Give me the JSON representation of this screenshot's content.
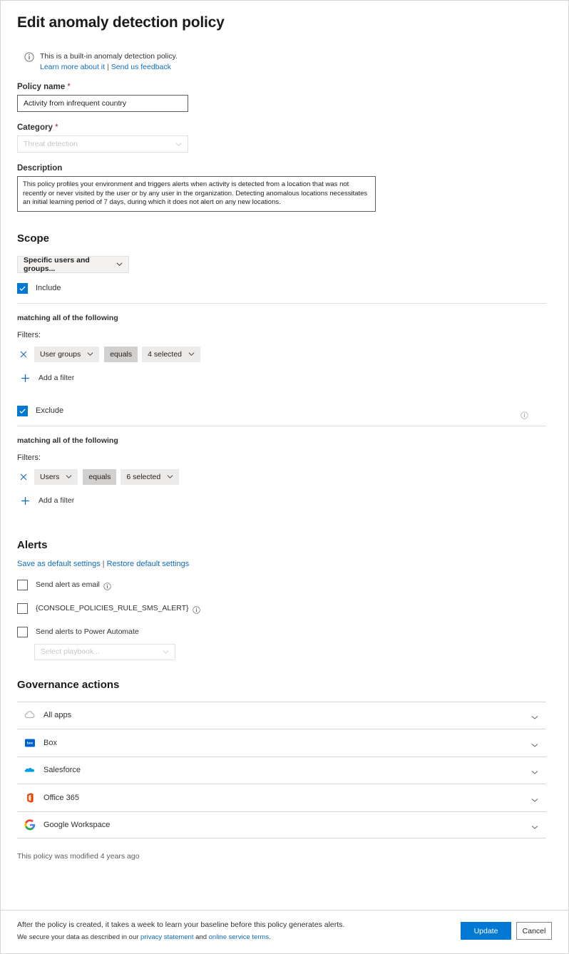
{
  "page": {
    "title": "Edit anomaly detection policy"
  },
  "banner": {
    "text": "This is a built-in anomaly detection policy.",
    "learn_more": "Learn more about it",
    "separator": "|",
    "feedback": "Send us feedback",
    "icon": "info-icon"
  },
  "policy_name": {
    "label": "Policy name",
    "required_marker": "*",
    "value": "Activity from infrequent country"
  },
  "category": {
    "label": "Category",
    "required_marker": "*",
    "value": "Threat detection",
    "disabled": true
  },
  "description": {
    "label": "Description",
    "value": "This policy profiles your environment and triggers alerts when activity is detected from a location that was not recently or never visited by the user or by any user in the organization. Detecting anomalous locations necessitates an initial learning period of 7 days, during which it does not alert on any new locations."
  },
  "scope": {
    "heading": "Scope",
    "dropdown_value": "Specific users and groups...",
    "include": {
      "label": "Include",
      "checked": true,
      "matching_text": "matching all of the following",
      "filters_label": "Filters:",
      "filter": {
        "field": "User groups",
        "operator": "equals",
        "value": "4 selected"
      },
      "add_filter": "Add a filter"
    },
    "exclude": {
      "label": "Exclude",
      "checked": true,
      "matching_text": "matching all of the following",
      "filters_label": "Filters:",
      "filter": {
        "field": "Users",
        "operator": "equals",
        "value": "6 selected"
      },
      "add_filter": "Add a filter"
    }
  },
  "alerts": {
    "heading": "Alerts",
    "save_default": "Save as default settings",
    "separator": "|",
    "restore_default": "Restore default settings",
    "options": [
      {
        "label": "Send alert as email",
        "checked": false,
        "has_info": true
      },
      {
        "label": "{CONSOLE_POLICIES_RULE_SMS_ALERT}",
        "checked": false,
        "has_info": true
      },
      {
        "label": "Send alerts to Power Automate",
        "checked": false,
        "has_info": false
      }
    ],
    "playbook_placeholder": "Select playbook..."
  },
  "governance": {
    "heading": "Governance actions",
    "rows": [
      {
        "label": "All apps",
        "icon": "all-apps-cloud-icon"
      },
      {
        "label": "Box",
        "icon": "box-icon"
      },
      {
        "label": "Salesforce",
        "icon": "salesforce-icon"
      },
      {
        "label": "Office 365",
        "icon": "office365-icon"
      },
      {
        "label": "Google Workspace",
        "icon": "google-workspace-icon"
      }
    ]
  },
  "modified_note": "This policy was modified 4 years ago",
  "footer": {
    "line1": "After the policy is created, it takes a week to learn your baseline before this policy generates alerts.",
    "line2_prefix": "We secure your data as described in our ",
    "privacy_link": "privacy statement",
    "line2_mid": " and ",
    "terms_link": "online service terms",
    "line2_suffix": ".",
    "update_label": "Update",
    "cancel_label": "Cancel"
  },
  "colors": {
    "accent": "#0078d4",
    "link": "#0f6cbd",
    "required": "#a4262c",
    "chip_bg": "#edebe9",
    "chip_op_bg": "#d2d0ce"
  }
}
